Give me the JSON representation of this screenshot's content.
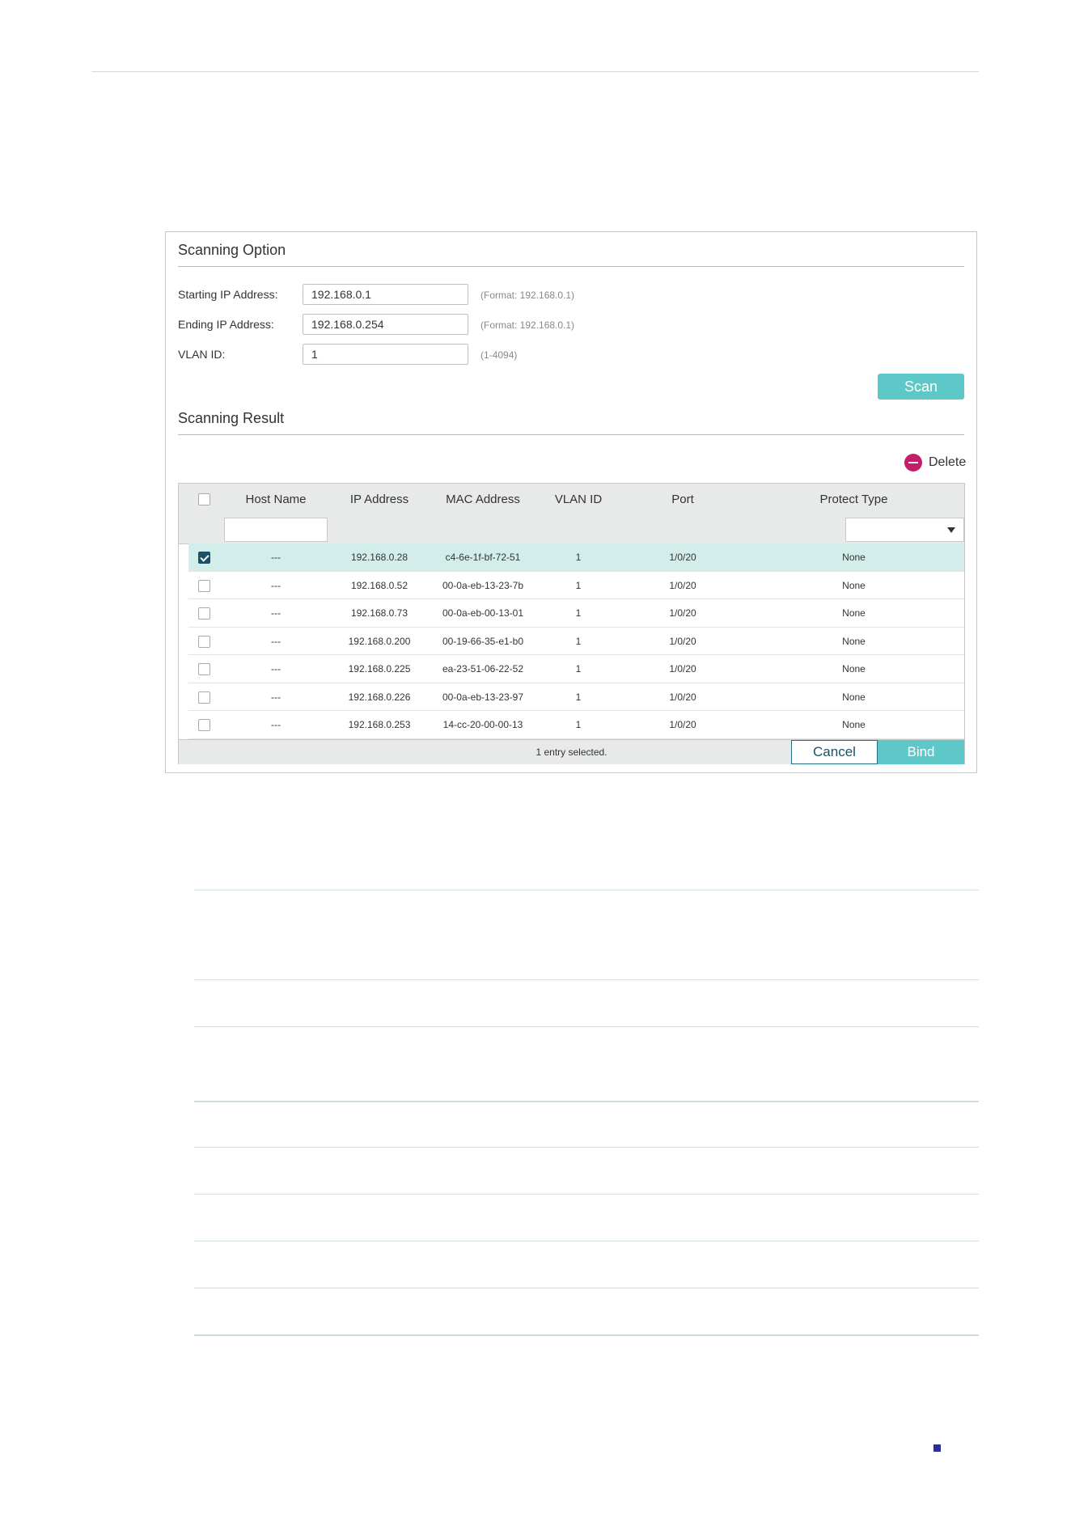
{
  "scanning_option": {
    "title": "Scanning Option",
    "starting_ip": {
      "label": "Starting IP Address:",
      "value": "192.168.0.1",
      "hint": "(Format: 192.168.0.1)"
    },
    "ending_ip": {
      "label": "Ending IP Address:",
      "value": "192.168.0.254",
      "hint": "(Format: 192.168.0.1)"
    },
    "vlan_id": {
      "label": "VLAN ID:",
      "value": "1",
      "hint": "(1-4094)"
    },
    "scan_label": "Scan"
  },
  "scanning_result": {
    "title": "Scanning Result",
    "delete_label": "Delete",
    "columns": [
      "Host Name",
      "IP Address",
      "MAC Address",
      "VLAN ID",
      "Port",
      "Protect Type"
    ],
    "rows": [
      {
        "selected": true,
        "host": "---",
        "ip": "192.168.0.28",
        "mac": "c4-6e-1f-bf-72-51",
        "vlan": "1",
        "port": "1/0/20",
        "protect": "None"
      },
      {
        "selected": false,
        "host": "---",
        "ip": "192.168.0.52",
        "mac": "00-0a-eb-13-23-7b",
        "vlan": "1",
        "port": "1/0/20",
        "protect": "None"
      },
      {
        "selected": false,
        "host": "---",
        "ip": "192.168.0.73",
        "mac": "00-0a-eb-00-13-01",
        "vlan": "1",
        "port": "1/0/20",
        "protect": "None"
      },
      {
        "selected": false,
        "host": "---",
        "ip": "192.168.0.200",
        "mac": "00-19-66-35-e1-b0",
        "vlan": "1",
        "port": "1/0/20",
        "protect": "None"
      },
      {
        "selected": false,
        "host": "---",
        "ip": "192.168.0.225",
        "mac": "ea-23-51-06-22-52",
        "vlan": "1",
        "port": "1/0/20",
        "protect": "None"
      },
      {
        "selected": false,
        "host": "---",
        "ip": "192.168.0.226",
        "mac": "00-0a-eb-13-23-97",
        "vlan": "1",
        "port": "1/0/20",
        "protect": "None"
      },
      {
        "selected": false,
        "host": "---",
        "ip": "192.168.0.253",
        "mac": "14-cc-20-00-00-13",
        "vlan": "1",
        "port": "1/0/20",
        "protect": "None"
      }
    ],
    "status": "1 entry selected.",
    "cancel_label": "Cancel",
    "bind_label": "Bind"
  },
  "colors": {
    "accent": "#5ec8c8",
    "selected_row": "#d3eeea",
    "delete": "#c41d6b",
    "check": "#1f4f66"
  }
}
